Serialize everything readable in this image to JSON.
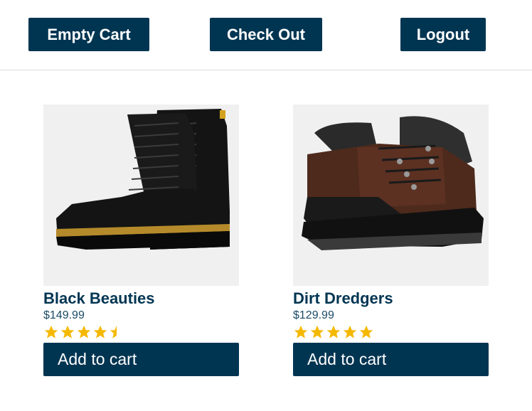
{
  "header": {
    "empty_cart_label": "Empty Cart",
    "check_out_label": "Check Out",
    "logout_label": "Logout"
  },
  "products": [
    {
      "name": "Black Beauties",
      "price": "$149.99",
      "rating": 4.5,
      "image": "black-leather-combat-boots",
      "add_label": "Add to cart"
    },
    {
      "name": "Dirt Dredgers",
      "price": "$129.99",
      "rating": 5,
      "image": "brown-leather-work-boot",
      "add_label": "Add to cart"
    }
  ],
  "colors": {
    "primary": "#003552",
    "star": "#f5b800",
    "image_bg": "#f0f0f0"
  }
}
